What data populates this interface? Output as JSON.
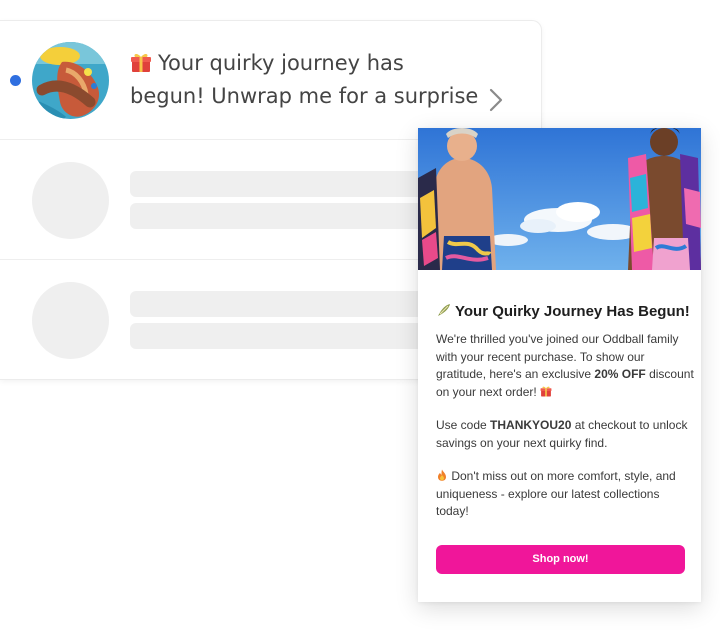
{
  "notification": {
    "text": "Your quirky journey has begun! Unwrap me for a surprise",
    "unread": true,
    "unread_color": "#2f6fe0"
  },
  "skeleton_rows": 2,
  "email": {
    "title": "Your Quirky Journey Has Begun!",
    "para1_a": "We're thrilled you've joined our Oddball family with your recent purchase. To show our gratitude, here's an exclusive ",
    "para1_bold": "20% OFF",
    "para1_b": " discount on your next order!",
    "para2_a": "Use code ",
    "para2_code": "THANKYOU20",
    "para2_b": " at checkout to unlock savings on your next quirky find.",
    "para3": "Don't miss out on more comfort, style, and uniqueness - explore our latest collections today!",
    "cta_label": "Shop now!",
    "cta_color": "#f0169a",
    "icons": {
      "title": "surfboard-icon",
      "gift": "gift-icon",
      "fire": "fire-icon"
    }
  }
}
